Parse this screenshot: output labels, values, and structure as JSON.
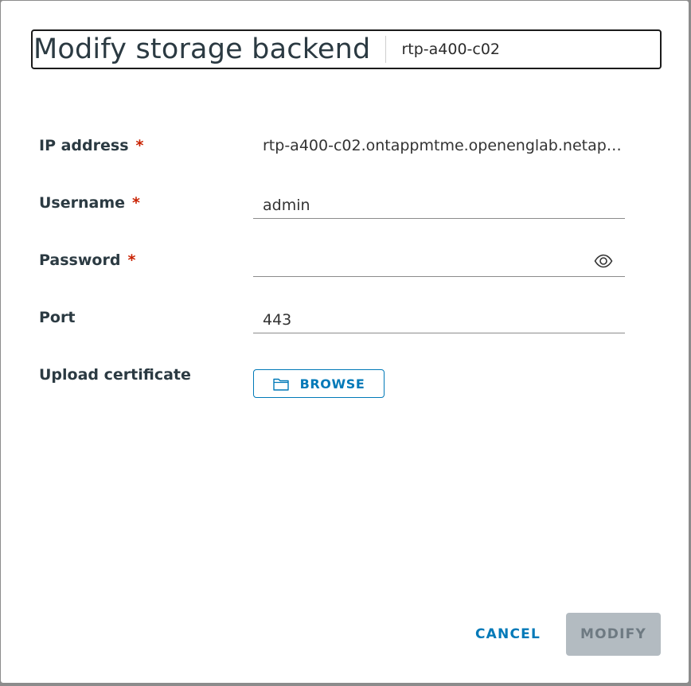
{
  "dialog": {
    "title": "Modify storage backend",
    "subtitle": "rtp-a400-c02"
  },
  "form": {
    "ip_address": {
      "label": "IP address",
      "required_mark": "*",
      "value": "rtp-a400-c02.ontappmtme.openenglab.netap…"
    },
    "username": {
      "label": "Username",
      "required_mark": "*",
      "value": "admin"
    },
    "password": {
      "label": "Password",
      "required_mark": "*",
      "value": "",
      "toggle_icon": "eye-icon"
    },
    "port": {
      "label": "Port",
      "value": "443"
    },
    "certificate": {
      "label": "Upload certificate",
      "button_label": "BROWSE",
      "button_icon": "folder-icon"
    }
  },
  "footer": {
    "cancel_label": "CANCEL",
    "modify_label": "MODIFY"
  },
  "colors": {
    "accent": "#0079b8",
    "required": "#c92100",
    "disabled_button": "#b3bbc1"
  }
}
